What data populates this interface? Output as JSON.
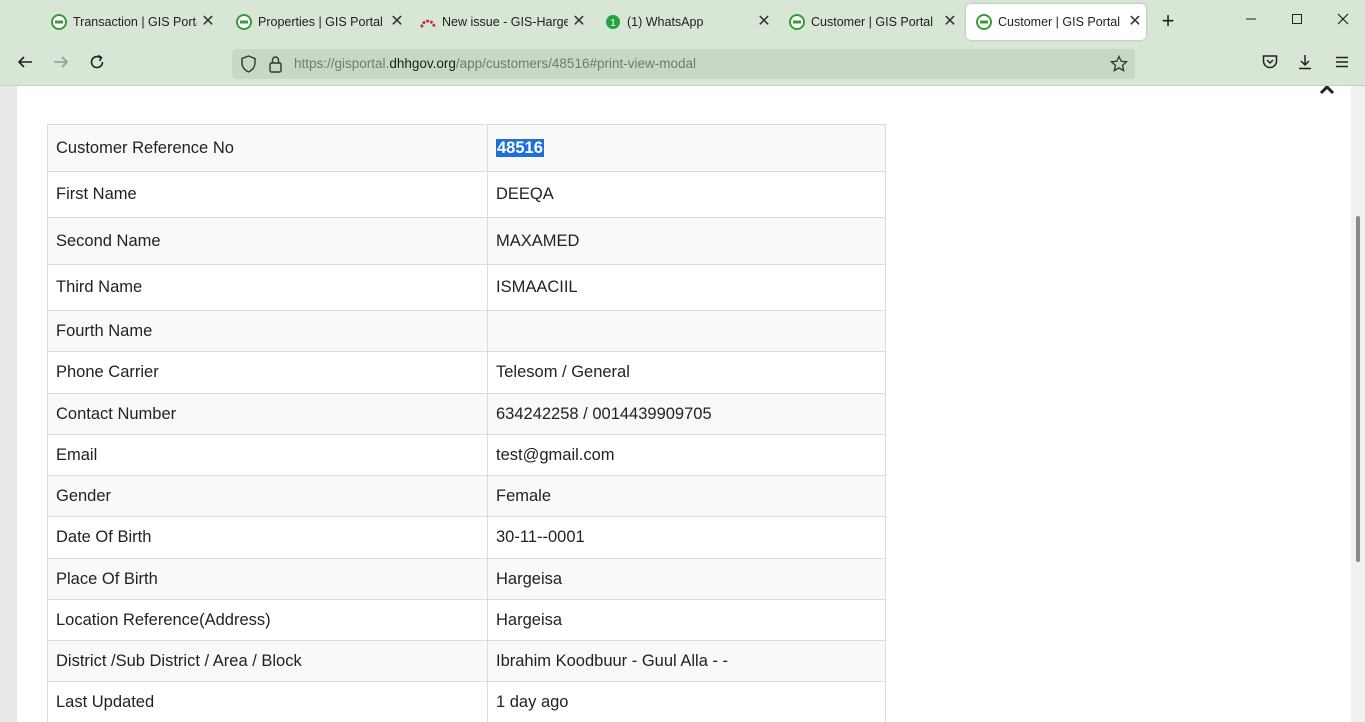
{
  "browser": {
    "tabs": [
      {
        "title": "Transaction | GIS Portal",
        "icon": "gis-portal-icon",
        "active": false
      },
      {
        "title": "Properties | GIS Portal",
        "icon": "gis-portal-icon",
        "active": false
      },
      {
        "title": "New issue - GIS-Hargeisa",
        "icon": "gitlab-icon",
        "active": false
      },
      {
        "title": "(1) WhatsApp",
        "icon": "whatsapp-icon",
        "active": false
      },
      {
        "title": "Customer | GIS Portal",
        "icon": "gis-portal-icon",
        "active": false
      },
      {
        "title": "Customer | GIS Portal",
        "icon": "gis-portal-icon",
        "active": true
      }
    ],
    "url": {
      "prefix": "https://gisportal.",
      "domain": "dhhgov.org",
      "path": "/app/customers/48516#print-view-modal"
    },
    "accent_color": "#d7e6d5"
  },
  "customer": {
    "rows": [
      {
        "label": "Customer Reference No",
        "value": "48516"
      },
      {
        "label": "First Name",
        "value": "DEEQA"
      },
      {
        "label": "Second Name",
        "value": "MAXAMED"
      },
      {
        "label": "Third Name",
        "value": "ISMAACIIL"
      },
      {
        "label": "Fourth Name",
        "value": ""
      },
      {
        "label": "Phone Carrier",
        "value": "Telesom / General"
      },
      {
        "label": "Contact Number",
        "value": "634242258 / 0014439909705"
      },
      {
        "label": "Email",
        "value": "test@gmail.com"
      },
      {
        "label": "Gender",
        "value": "Female"
      },
      {
        "label": "Date Of Birth",
        "value": "30-11--0001"
      },
      {
        "label": "Place Of Birth",
        "value": "Hargeisa"
      },
      {
        "label": "Location Reference(Address)",
        "value": "Hargeisa"
      },
      {
        "label": "District /Sub District / Area / Block",
        "value": "Ibrahim Koodbuur - Guul Alla - -"
      },
      {
        "label": "Last Updated",
        "value": "1 day ago"
      }
    ]
  }
}
